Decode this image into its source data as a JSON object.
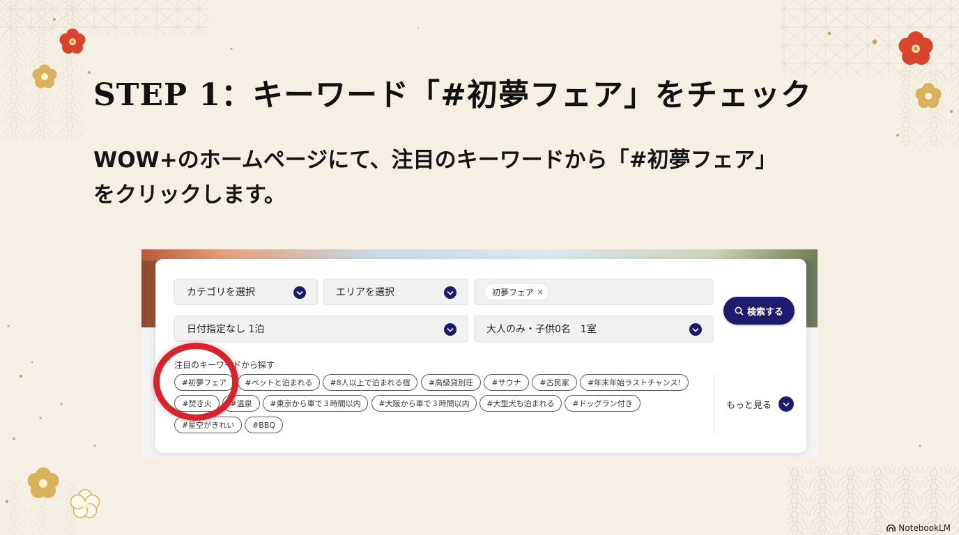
{
  "slide": {
    "title": "STEP 1：キーワード「#初夢フェア」をチェック",
    "lead_line1": "WOW+のホームページにて、注目のキーワードから「#初夢フェア」",
    "lead_line2": "をクリックします。"
  },
  "search_form": {
    "category_select": "カテゴリを選択",
    "area_select": "エリアを選択",
    "keyword_chip": "初夢フェア",
    "keyword_chip_remove": "×",
    "date_select": "日付指定なし 1泊",
    "guests_select": "大人のみ・子供0名　1室",
    "search_button": "検索する"
  },
  "keywords": {
    "label": "注目のキーワードから探す",
    "tags": [
      "#初夢フェア",
      "#ペットと泊まれる",
      "#8人以上で泊まれる宿",
      "#高級貸別荘",
      "#サウナ",
      "#古民家",
      "#年末年始ラストチャンス!",
      "#焚き火",
      "#温泉",
      "#東京から車で３時間以内",
      "#大阪から車で３時間以内",
      "#大型犬も泊まれる",
      "#ドッグラン付き",
      "#星空がきれい",
      "#BBQ"
    ],
    "more_label": "もっと見る"
  },
  "branding": {
    "label": "NotebookLM"
  },
  "colors": {
    "background": "#f5f0e3",
    "navy": "#1e1a6e",
    "highlight_red": "#d8232a",
    "plum_red": "#d9452c",
    "plum_gold": "#d9b25c"
  },
  "icons": {
    "chevron": "chevron-down-icon",
    "search": "search-icon",
    "brand": "notebooklm-logo-icon"
  }
}
